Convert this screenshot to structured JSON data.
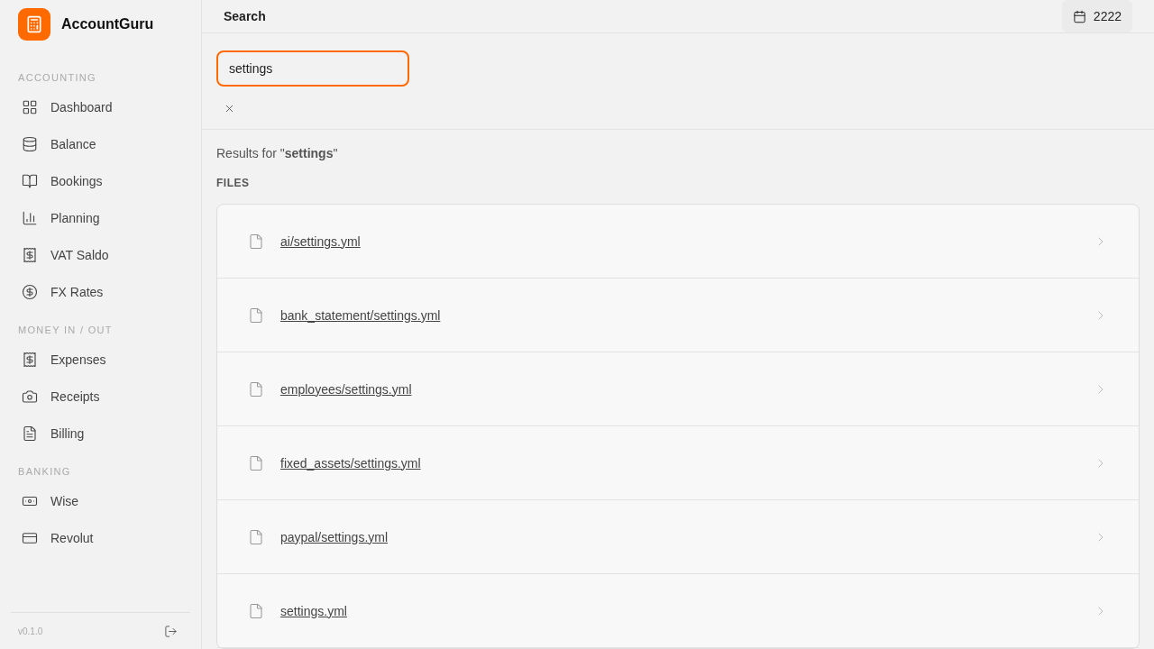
{
  "app": {
    "name": "AccountGuru"
  },
  "sidebar": {
    "sections": [
      {
        "title": "ACCOUNTING",
        "items": [
          {
            "label": "Dashboard"
          },
          {
            "label": "Balance"
          },
          {
            "label": "Bookings"
          },
          {
            "label": "Planning"
          },
          {
            "label": "VAT Saldo"
          },
          {
            "label": "FX Rates"
          }
        ]
      },
      {
        "title": "MONEY IN / OUT",
        "items": [
          {
            "label": "Expenses"
          },
          {
            "label": "Receipts"
          },
          {
            "label": "Billing"
          }
        ]
      },
      {
        "title": "BANKING",
        "items": [
          {
            "label": "Wise"
          },
          {
            "label": "Revolut"
          }
        ]
      }
    ],
    "version": "v0.1.0"
  },
  "header": {
    "title": "Search",
    "year": "2222"
  },
  "search": {
    "value": "settings"
  },
  "results": {
    "summary": "Results for \"**settings**\"",
    "section": "FILES",
    "files": [
      {
        "path": "ai/settings.yml"
      },
      {
        "path": "bank_statement/settings.yml"
      },
      {
        "path": "employees/settings.yml"
      },
      {
        "path": "fixed_assets/settings.yml"
      },
      {
        "path": "paypal/settings.yml"
      },
      {
        "path": "settings.yml"
      }
    ]
  }
}
